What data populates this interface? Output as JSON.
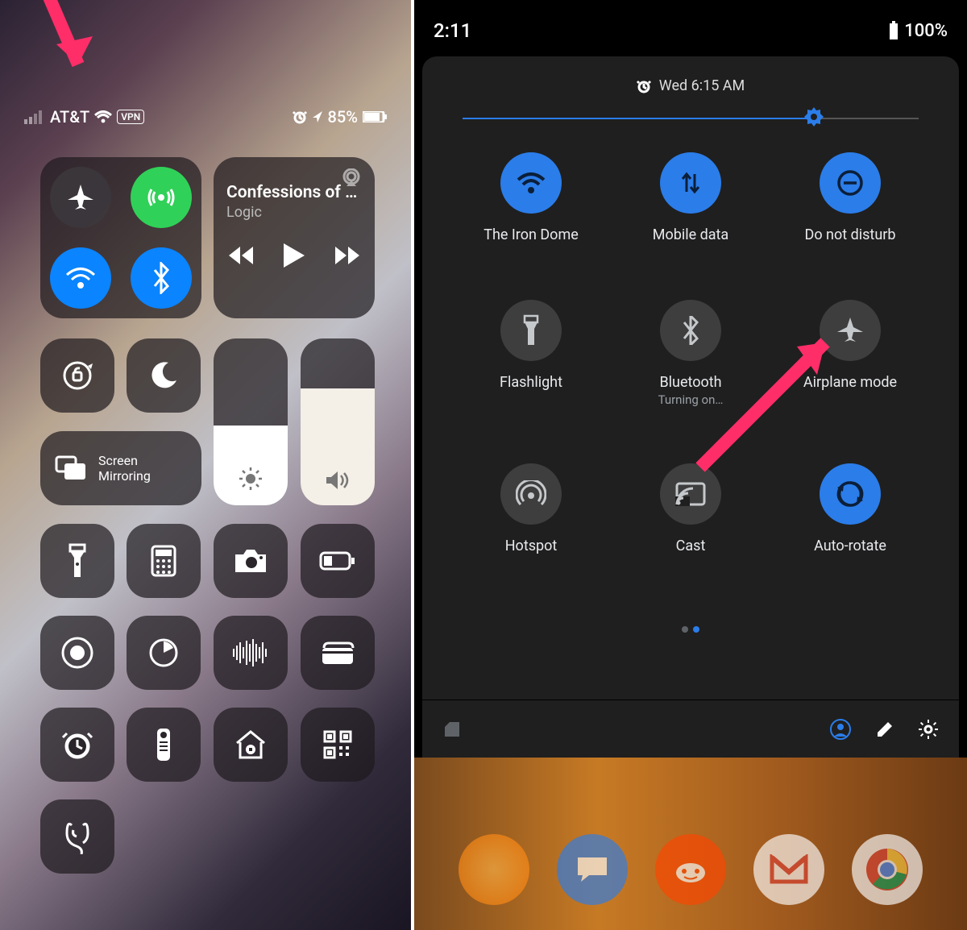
{
  "ios": {
    "status": {
      "carrier": "AT&T",
      "vpn": "VPN",
      "battery_pct": "85%"
    },
    "media": {
      "title": "Confessions of a...",
      "artist": "Logic"
    },
    "screen_mirroring_label": "Screen\nMirroring",
    "tiles": {
      "airplane": "airplane-mode",
      "cellular": "cellular-data",
      "wifi": "wifi",
      "bluetooth": "bluetooth",
      "orientation_lock": "orientation-lock",
      "do_not_disturb": "do-not-disturb",
      "brightness": "brightness-slider",
      "volume": "volume-slider",
      "flashlight": "flashlight",
      "calculator": "calculator",
      "camera": "camera",
      "low_power": "low-power-mode",
      "screen_record": "screen-recording",
      "timer": "timer",
      "hearing": "hearing",
      "wallet": "wallet",
      "alarm": "alarm",
      "remote": "remote",
      "home": "home",
      "qr": "qr-code",
      "accessibility_ear": "accessibility-hearing"
    }
  },
  "android": {
    "status": {
      "clock": "2:11",
      "battery_pct": "100%"
    },
    "alarm_text": "Wed 6:15 AM",
    "brightness_pct": 77,
    "tiles": [
      {
        "label": "The Iron Dome",
        "state": "on",
        "icon": "wifi"
      },
      {
        "label": "Mobile data",
        "state": "on",
        "icon": "data"
      },
      {
        "label": "Do not disturb",
        "state": "on",
        "icon": "dnd"
      },
      {
        "label": "Flashlight",
        "state": "off",
        "icon": "flashlight"
      },
      {
        "label": "Bluetooth",
        "state": "off",
        "icon": "bluetooth",
        "sub": "Turning on…"
      },
      {
        "label": "Airplane mode",
        "state": "off",
        "icon": "airplane"
      },
      {
        "label": "Hotspot",
        "state": "off",
        "icon": "hotspot"
      },
      {
        "label": "Cast",
        "state": "off",
        "icon": "cast"
      },
      {
        "label": "Auto-rotate",
        "state": "on",
        "icon": "rotate"
      }
    ],
    "dock_apps": [
      "flare",
      "messages",
      "reddit",
      "gmail",
      "chrome"
    ]
  },
  "annotations": {
    "ios_arrow_target": "airplane-toggle",
    "android_arrow_target": "airplane-mode-toggle"
  }
}
